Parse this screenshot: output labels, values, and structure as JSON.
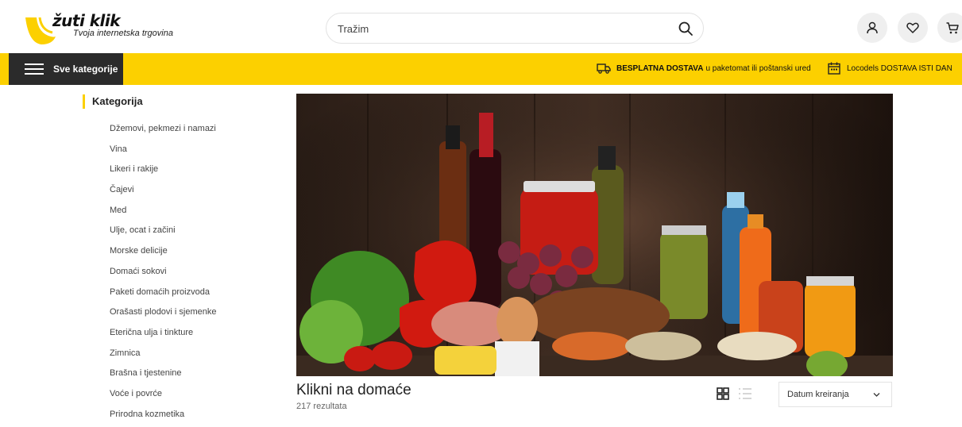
{
  "brand": {
    "name": "žuti klik",
    "tagline": "Tvoja internetska trgovina",
    "accent_color": "#fcd000"
  },
  "search": {
    "placeholder": "Tražim",
    "icon": "search-icon"
  },
  "header_actions": [
    {
      "icon": "user-icon"
    },
    {
      "icon": "heart-icon"
    },
    {
      "icon": "cart-icon"
    }
  ],
  "nav": {
    "all_categories": "Sve kategorije",
    "promo_1": {
      "bold": "BESPLATNA DOSTAVA",
      "rest": "u paketomat ili poštanski ured",
      "icon": "delivery-truck-icon"
    },
    "promo_2": {
      "text": "Locodels DOSTAVA ISTI DAN",
      "icon": "calendar-icon"
    }
  },
  "sidebar": {
    "title": "Kategorija",
    "items": [
      "Džemovi, pekmezi i namazi",
      "Vina",
      "Likeri i rakije",
      "Čajevi",
      "Med",
      "Ulje, ocat i začini",
      "Morske delicije",
      "Domaći sokovi",
      "Paketi domaćih proizvoda",
      "Orašasti plodovi i sjemenke",
      "Eterična ulja i tinkture",
      "Zimnica",
      "Brašna i tjestenine",
      "Voće i povrće",
      "Prirodna kozmetika"
    ]
  },
  "main": {
    "title": "Klikni na domaće",
    "result_count": "217 rezultata",
    "sort_selected": "Datum kreiranja",
    "view_modes": [
      "grid-view-icon",
      "list-view-icon"
    ]
  }
}
